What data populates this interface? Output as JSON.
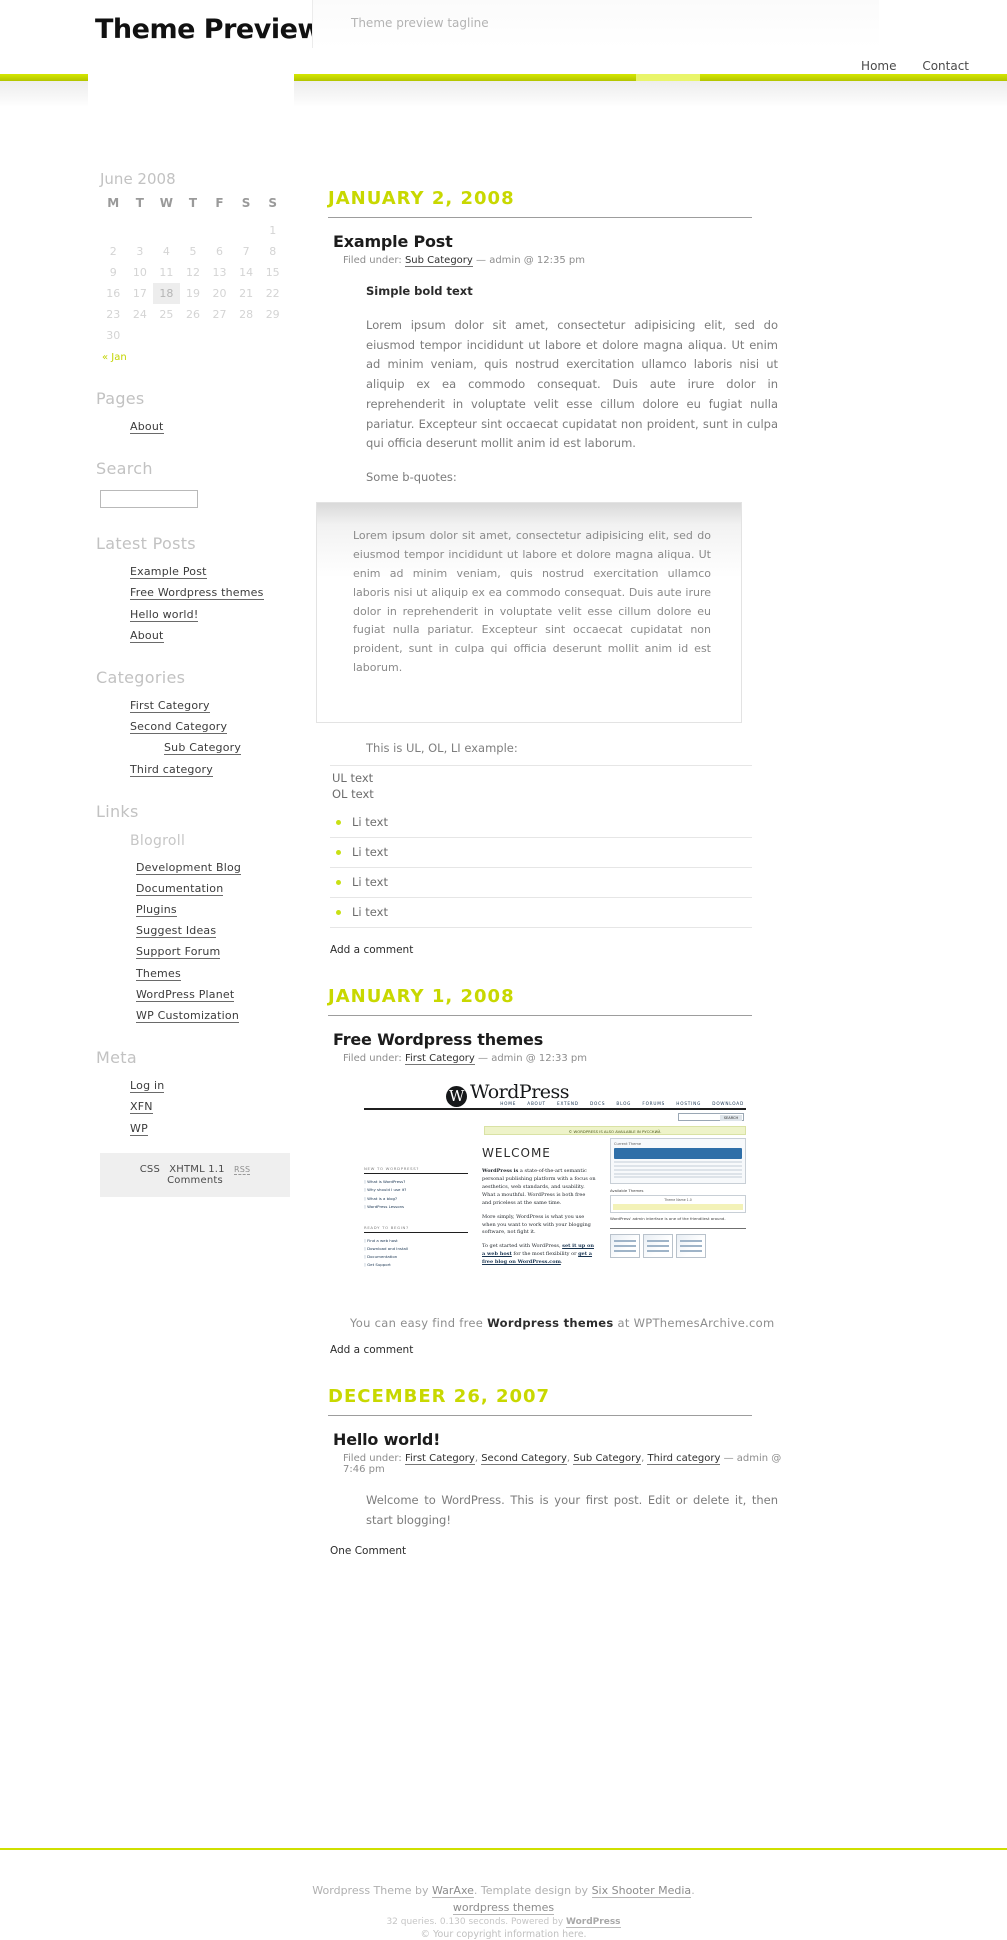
{
  "header": {
    "blog_title": "Theme Preview",
    "tagline": "Theme preview tagline",
    "nav": [
      {
        "label": "Home"
      },
      {
        "label": "Contact"
      }
    ]
  },
  "sidebar": {
    "calendar": {
      "caption": "June 2008",
      "weekdays": [
        "M",
        "T",
        "W",
        "T",
        "F",
        "S",
        "S"
      ],
      "weeks": [
        [
          "",
          "",
          "",
          "",
          "",
          "",
          "1"
        ],
        [
          "2",
          "3",
          "4",
          "5",
          "6",
          "7",
          "8"
        ],
        [
          "9",
          "10",
          "11",
          "12",
          "13",
          "14",
          "15"
        ],
        [
          "16",
          "17",
          "18",
          "19",
          "20",
          "21",
          "22"
        ],
        [
          "23",
          "24",
          "25",
          "26",
          "27",
          "28",
          "29"
        ],
        [
          "30",
          "",
          "",
          "",
          "",
          "",
          ""
        ]
      ],
      "today": "18",
      "prev_label": "« Jan"
    },
    "pages": {
      "title": "Pages",
      "items": [
        {
          "label": "About"
        }
      ]
    },
    "search": {
      "title": "Search",
      "value": "",
      "placeholder": ""
    },
    "latest_posts": {
      "title": "Latest Posts",
      "items": [
        {
          "label": "Example Post"
        },
        {
          "label": "Free Wordpress themes"
        },
        {
          "label": "Hello world!"
        },
        {
          "label": "About"
        }
      ]
    },
    "categories": {
      "title": "Categories",
      "items": [
        {
          "label": "First Category"
        },
        {
          "label": "Second Category"
        },
        {
          "label": "Sub Category"
        },
        {
          "label": "Third category"
        }
      ]
    },
    "links": {
      "title": "Links",
      "blogroll_title": "Blogroll",
      "items": [
        {
          "label": "Development Blog"
        },
        {
          "label": "Documentation"
        },
        {
          "label": "Plugins"
        },
        {
          "label": "Suggest Ideas"
        },
        {
          "label": "Support Forum"
        },
        {
          "label": "Themes"
        },
        {
          "label": "WordPress Planet"
        },
        {
          "label": "WP Customization"
        }
      ]
    },
    "meta": {
      "title": "Meta",
      "items": [
        {
          "label": "Log in"
        },
        {
          "label": "XFN"
        },
        {
          "label": "WP"
        }
      ]
    },
    "badges": {
      "css": "CSS",
      "xhtml": "XHTML 1.1",
      "rss": "RSS",
      "comments": "Comments"
    }
  },
  "posts": [
    {
      "date": "JANUARY 2, 2008",
      "title": "Example Post",
      "meta_prefix": "Filed under:",
      "category": "Sub Category",
      "meta_suffix": "— admin @ 12:35 pm",
      "bold_line": "Simple bold text",
      "paragraph": "Lorem ipsum dolor sit amet, consectetur adipisicing elit, sed do eiusmod tempor incididunt ut labore et dolore magna aliqua. Ut enim ad minim veniam, quis nostrud exercitation ullamco laboris nisi ut aliquip ex ea commodo consequat. Duis aute irure dolor in reprehenderit in voluptate velit esse cillum dolore eu fugiat nulla pariatur. Excepteur sint occaecat cupidatat non proident, sunt in culpa qui officia deserunt mollit anim id est laborum.",
      "bquote_intro": "Some b-quotes:",
      "blockquote": "Lorem ipsum dolor sit amet, consectetur adipisicing elit, sed do eiusmod tempor incididunt ut labore et dolore magna aliqua. Ut enim ad minim veniam, quis nostrud exercitation ullamco laboris nisi ut aliquip ex ea commodo consequat. Duis aute irure dolor in reprehenderit in voluptate velit esse cillum dolore eu fugiat nulla pariatur. Excepteur sint occaecat cupidatat non proident, sunt in culpa qui officia deserunt mollit anim id est laborum.",
      "list_intro": "This is UL, OL, LI example:",
      "ul_text": "UL text",
      "ol_text": "OL text",
      "li_items": [
        "Li text",
        "Li text",
        "Li text",
        "Li text"
      ],
      "comment_link": "Add a comment"
    },
    {
      "date": "JANUARY 1, 2008",
      "title": "Free Wordpress themes",
      "meta_prefix": "Filed under:",
      "category": "First Category",
      "meta_suffix": "— admin @ 12:33 pm",
      "caption_pre": "You can easy find free",
      "caption_link": "Wordpress themes",
      "caption_post": "at WPThemesArchive.com",
      "comment_link": "Add a comment"
    },
    {
      "date": "DECEMBER 26, 2007",
      "title": "Hello world!",
      "meta_prefix": "Filed under:",
      "categories": [
        "First Category",
        "Second Category",
        "Sub Category",
        "Third category"
      ],
      "meta_suffix": "— admin @ 7:46 pm",
      "paragraph": "Welcome to WordPress. This is your first post. Edit or delete it, then start blogging!",
      "comment_link": "One Comment"
    }
  ],
  "wp_screenshot": {
    "logo": "WordPress",
    "nav": [
      "HOME",
      "ABOUT",
      "EXTEND",
      "DOCS",
      "BLOG",
      "FORUMS",
      "HOSTING",
      "DOWNLOAD"
    ],
    "search_button": "SEARCH",
    "ru_notice": "© WORDPRESS IS ALSO AVAILABLE IN РУССКИЙ.",
    "welcome": "WELCOME",
    "new_heading": "NEW TO WORDPRESS?",
    "new_items": [
      "What is WordPress?",
      "Why should I use it?",
      "What is a blog?",
      "WordPress Lessons"
    ],
    "ready_heading": "READY TO BEGIN?",
    "ready_items": [
      "Find a web host",
      "Download and Install",
      "Documentation",
      "Get Support"
    ],
    "body1_bold": "WordPress is",
    "body1": " a state-of-the-art semantic personal publishing platform with a focus on aesthetics, web standards, and usability. What a mouthful. WordPress is both free and priceless at the same time.",
    "body2": "More simply, WordPress is what you use when you want to work with your blogging software, not fight it.",
    "body3_pre": "To get started with WordPress, ",
    "body3_link1": "set it up on a web host",
    "body3_mid": " for the most flexibility or ",
    "body3_link2": "get a free blog on WordPress.com",
    "body3_end": ".",
    "panel_title": "Current Theme",
    "avail_title": "Available Themes",
    "theme_name": "Theme Name 1.0",
    "admin_caption": "WordPress' admin interface is one of the friendliest around."
  },
  "footer": {
    "line1_pre": "Wordpress Theme by ",
    "line1_link1": "WarAxe",
    "line1_mid": ". Template design by ",
    "line1_link2": "Six Shooter Media",
    "line1_end": ".",
    "line2_link": "wordpress themes",
    "line3_pre": "32 queries. 0.130 seconds. Powered by ",
    "line3_link": "WordPress",
    "line4": "© Your copyright information here."
  },
  "colors": {
    "accent_lime": "#c8d800",
    "bar_lime": "#c2d400",
    "bullet_lime": "#c8e014"
  }
}
